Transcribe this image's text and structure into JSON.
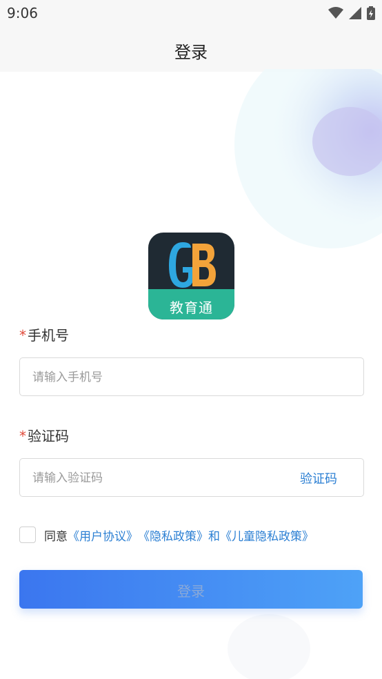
{
  "status_bar": {
    "time": "9:06"
  },
  "header": {
    "title": "登录"
  },
  "logo": {
    "text": "教育通"
  },
  "form": {
    "phone": {
      "required_mark": "*",
      "label": "手机号",
      "placeholder": "请输入手机号"
    },
    "code": {
      "required_mark": "*",
      "label": "验证码",
      "placeholder": "请输入验证码",
      "button_label": "验证码"
    }
  },
  "agreement": {
    "prefix": "同意",
    "user_agreement": "《用户协议》",
    "privacy_policy": "《隐私政策》",
    "and": "和",
    "child_privacy_policy": "《儿童隐私政策》"
  },
  "login_button": {
    "label": "登录"
  },
  "colors": {
    "accent": "#2b7fd3",
    "required": "#e04a3a",
    "button_start": "#3b76ef",
    "button_end": "#4ea2f7"
  }
}
